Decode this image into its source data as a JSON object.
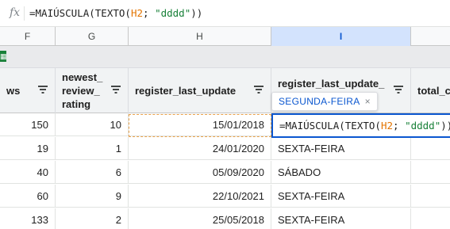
{
  "formula_bar": {
    "icon": "fx-icon",
    "parts": [
      "=MAIÚSCULA(TEXTO(",
      "H2",
      "; ",
      "\"dddd\"",
      "))"
    ]
  },
  "columns": [
    "F",
    "G",
    "H",
    "I"
  ],
  "headers": {
    "f": "ws",
    "g": [
      "newest_",
      "review_",
      "rating"
    ],
    "h": "register_last_update",
    "i": "register_last_update_",
    "j": "total_c"
  },
  "preview_chip": {
    "text": "SEGUNDA-FEIRA",
    "close": "×"
  },
  "editor": {
    "parts": [
      "=MAIÚSCULA(TEXTO(",
      "H2",
      "; ",
      "\"dddd\"",
      "))"
    ]
  },
  "rows": [
    {
      "ws": "150",
      "rating": "10",
      "date": "15/01/2018",
      "weekday": ""
    },
    {
      "ws": "19",
      "rating": "1",
      "date": "24/01/2020",
      "weekday": "SEXTA-FEIRA"
    },
    {
      "ws": "40",
      "rating": "6",
      "date": "05/09/2020",
      "weekday": "SÁBADO"
    },
    {
      "ws": "60",
      "rating": "9",
      "date": "22/10/2021",
      "weekday": "SEXTA-FEIRA"
    },
    {
      "ws": "133",
      "rating": "2",
      "date": "25/05/2018",
      "weekday": "SEXTA-FEIRA"
    }
  ],
  "colors": {
    "selection_blue": "#0b57d0",
    "ref_orange": "#e37400",
    "string_green": "#188038",
    "marquee": "#e8a14a"
  }
}
